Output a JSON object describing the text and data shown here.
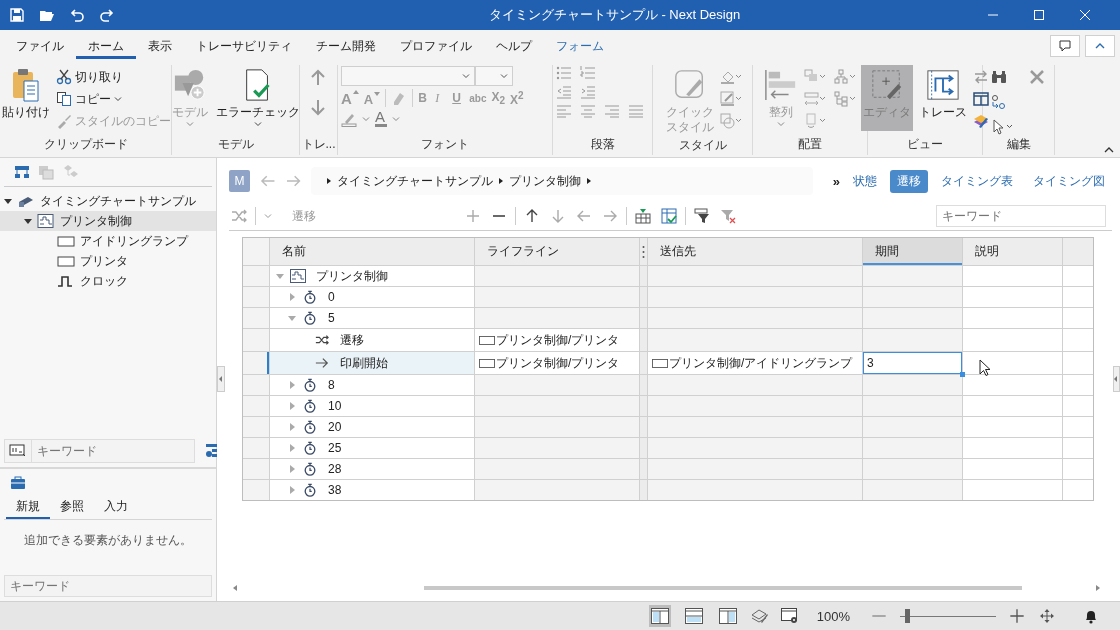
{
  "window": {
    "title": "タイミングチャートサンプル - Next Design"
  },
  "ribbon_tabs": [
    {
      "label": "ファイル",
      "selected": false,
      "contextual": false
    },
    {
      "label": "ホーム",
      "selected": true,
      "contextual": false
    },
    {
      "label": "表示",
      "selected": false,
      "contextual": false
    },
    {
      "label": "トレーサビリティ",
      "selected": false,
      "contextual": false
    },
    {
      "label": "チーム開発",
      "selected": false,
      "contextual": false
    },
    {
      "label": "プロファイル",
      "selected": false,
      "contextual": false
    },
    {
      "label": "ヘルプ",
      "selected": false,
      "contextual": false
    },
    {
      "label": "フォーム",
      "selected": false,
      "contextual": true
    }
  ],
  "ribbon": {
    "clipboard": {
      "label": "クリップボード",
      "paste": "貼り付け",
      "cut": "切り取り",
      "copy": "コピー",
      "copy_style": {
        "label": "スタイルのコピー",
        "disabled": true
      }
    },
    "model": {
      "label": "モデル",
      "model_button": {
        "label": "モデル",
        "disabled": true
      },
      "error_check": {
        "label": "エラーチェック",
        "disabled": false
      }
    },
    "trace": {
      "label": "トレ..."
    },
    "font": {
      "label": "フォント",
      "grow": "A",
      "shrink": "A",
      "buttons": [
        "B",
        "I",
        "U",
        "abc",
        "X$_{2}$",
        "X$^{2}$"
      ],
      "font_color": "A"
    },
    "paragraph": {
      "label": "段落"
    },
    "style": {
      "label": "スタイル",
      "quick_style": {
        "lines": [
          "クイック",
          "スタイル"
        ],
        "disabled": true
      }
    },
    "arrange": {
      "label": "配置",
      "align": {
        "label": "整列",
        "disabled": true
      }
    },
    "view": {
      "label": "ビュー",
      "editor": {
        "label": "エディタ",
        "selected": true
      },
      "trace": {
        "label": "トレース",
        "selected": false
      }
    },
    "edit": {
      "label": "編集"
    }
  },
  "model_tree": [
    {
      "label": "タイミングチャートサンプル",
      "kind": "project",
      "expanded": true,
      "selected": false,
      "children": [
        {
          "label": "プリンタ制御",
          "kind": "timing",
          "expanded": true,
          "selected": true,
          "children": [
            {
              "label": "アイドリングランプ",
              "kind": "lifeline",
              "selected": false
            },
            {
              "label": "プリンタ",
              "kind": "lifeline",
              "selected": false
            },
            {
              "label": "クロック",
              "kind": "clock",
              "selected": false
            }
          ]
        }
      ]
    }
  ],
  "tree_search": {
    "placeholder": "キーワード"
  },
  "toolbox": {
    "tabs": [
      {
        "label": "新規",
        "selected": true
      },
      {
        "label": "参照",
        "selected": false
      },
      {
        "label": "入力",
        "selected": false
      }
    ],
    "empty_message": "追加できる要素がありません。",
    "search": {
      "placeholder": "キーワード"
    }
  },
  "breadcrumb": {
    "badge": "M",
    "items": [
      "タイミングチャートサンプル",
      "プリンタ制御"
    ]
  },
  "view_tabs": {
    "overflow": "»",
    "tabs": [
      {
        "label": "状態",
        "selected": false
      },
      {
        "label": "遷移",
        "selected": true
      },
      {
        "label": "タイミング表",
        "selected": false
      },
      {
        "label": "タイミング図",
        "selected": false
      }
    ]
  },
  "grid_toolbar": {
    "type_label": "遷移",
    "search": {
      "placeholder": "キーワード"
    }
  },
  "table": {
    "columns": [
      {
        "label": "名前",
        "selected": false
      },
      {
        "label": "ライフライン",
        "selected": false
      },
      {
        "label": "送信先",
        "selected": false
      },
      {
        "label": "期間",
        "selected": true
      },
      {
        "label": "説明",
        "selected": false
      }
    ],
    "rows": [
      {
        "name": "プリンタ制御",
        "kind": "timing",
        "expanded": true,
        "selected": false,
        "children": [
          {
            "name": "0",
            "kind": "time",
            "expanded": false,
            "selected": false
          },
          {
            "name": "5",
            "kind": "time",
            "expanded": true,
            "selected": false,
            "children": [
              {
                "name": "遷移",
                "kind": "transition",
                "lifeline": "プリンタ制御/プリンタ",
                "selected": false
              },
              {
                "name": "印刷開始",
                "kind": "message",
                "lifeline": "プリンタ制御/プリンタ",
                "target": "プリンタ制御/アイドリングランプ",
                "period": "3",
                "selected": true
              }
            ]
          },
          {
            "name": "8",
            "kind": "time",
            "expanded": false,
            "selected": false
          },
          {
            "name": "10",
            "kind": "time",
            "expanded": false,
            "selected": false
          },
          {
            "name": "20",
            "kind": "time",
            "expanded": false,
            "selected": false
          },
          {
            "name": "25",
            "kind": "time",
            "expanded": false,
            "selected": false
          },
          {
            "name": "28",
            "kind": "time",
            "expanded": false,
            "selected": false
          },
          {
            "name": "38",
            "kind": "time",
            "expanded": false,
            "selected": false
          }
        ]
      }
    ]
  },
  "status_bar": {
    "layouts": [
      {
        "selected": true
      },
      {
        "selected": false
      },
      {
        "selected": false
      }
    ],
    "zoom_text": "100%",
    "zoom": {
      "level": 0.05
    }
  }
}
